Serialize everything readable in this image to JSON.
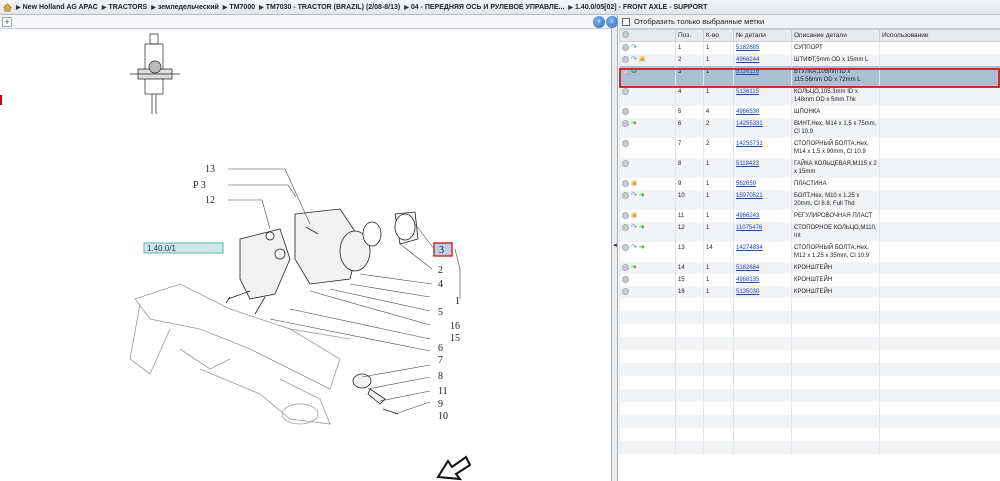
{
  "breadcrumb": [
    "New Holland AG APAC",
    "TRACTORS",
    "земледельческий",
    "TM7000",
    "TM7030 - TRACTOR (BRAZIL) (2/08-8/13)",
    "04 - ПЕРЕДНЯЯ ОСЬ И РУЛЕВОЕ УПРАВЛЕ...",
    "1.40.0/05[02] - FRONT AXLE - SUPPORT"
  ],
  "filter_label": "Отобразить только выбранные метки",
  "table": {
    "headers": [
      "Поз.",
      "К-во",
      "№ детали",
      "Описание детали",
      "Использование"
    ],
    "rows": [
      {
        "pos": "1",
        "qty": "1",
        "part": "5182685",
        "desc": "СУППОРТ",
        "icons": [
          "blue"
        ]
      },
      {
        "pos": "2",
        "qty": "1",
        "part": "4966244",
        "desc": "ШТИФТ,5mm OD x 15mm L",
        "icons": [
          "blue",
          "yellow"
        ]
      },
      {
        "pos": "3",
        "qty": "1",
        "part": "5136116",
        "desc": "ВТУЛКА,105mm ID x 115.56mm OD x 72mm L",
        "icons": [
          "teal"
        ],
        "selected": true
      },
      {
        "pos": "4",
        "qty": "1",
        "part": "5136115",
        "desc": "КОЛЬЦО,105.3mm ID x 148mm OD x 5mm Thk",
        "icons": []
      },
      {
        "pos": "5",
        "qty": "4",
        "part": "4966530",
        "desc": "ШПОНКА",
        "icons": []
      },
      {
        "pos": "6",
        "qty": "2",
        "part": "14255331",
        "desc": "ВИНТ,Hex, M14 x 1.5 x 75mm, Cl 10.9",
        "icons": [
          "green"
        ]
      },
      {
        "pos": "7",
        "qty": "2",
        "part": "14255731",
        "desc": "СТОПОРНЫЙ БОЛТА,Hex, M14 x 1.5 x 90mm, Cl 10.9",
        "icons": []
      },
      {
        "pos": "8",
        "qty": "1",
        "part": "5118423",
        "desc": "ГАЙКА КОЛЬЦЕВАЯ,M115 x 2 x 15mm",
        "icons": []
      },
      {
        "pos": "9",
        "qty": "1",
        "part": "562659",
        "desc": "ПЛАСТИНА",
        "icons": [
          "yellow"
        ]
      },
      {
        "pos": "10",
        "qty": "1",
        "part": "15970521",
        "desc": "БОЛТ,Hex, M10 x 1.25 x 20mm, Cl 8.8, Full Thd",
        "icons": [
          "blue",
          "green"
        ]
      },
      {
        "pos": "11",
        "qty": "1",
        "part": "4966243",
        "desc": "РЕГУЛИРОВОЧНАЯ ПЛАСТ",
        "icons": [
          "yellow"
        ]
      },
      {
        "pos": "12",
        "qty": "1",
        "part": "11075476",
        "desc": "СТОПОРНОЕ КОЛЬЦО,M110, Int",
        "icons": [
          "blue",
          "green"
        ]
      },
      {
        "pos": "13",
        "qty": "14",
        "part": "14274834",
        "desc": "СТОПОРНЫЙ БОЛТА,Hex, M12 x 1.25 x 35mm, Cl 10.9",
        "icons": [
          "blue",
          "green"
        ]
      },
      {
        "pos": "14",
        "qty": "1",
        "part": "5182684",
        "desc": "КРОНШТЕЙН",
        "icons": [
          "green"
        ]
      },
      {
        "pos": "15",
        "qty": "1",
        "part": "4968135",
        "desc": "КРОНШТЕЙН",
        "icons": []
      },
      {
        "pos": "16",
        "qty": "1",
        "part": "5135030",
        "desc": "КРОНШТЕЙН",
        "icons": []
      }
    ]
  },
  "diagram": {
    "ref_label": "1.40.0/1",
    "callouts_left": [
      "13",
      "P 3",
      "12"
    ],
    "callouts_right": [
      "3",
      "2",
      "4",
      "1",
      "5",
      "16",
      "15",
      "6",
      "7",
      "8",
      "11",
      "9",
      "10"
    ]
  },
  "colors": {
    "selection": "#aac0d4",
    "highlight_border": "#d32b2b",
    "link": "#1a45c9"
  }
}
